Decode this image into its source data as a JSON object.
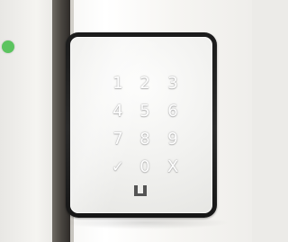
{
  "keypad": {
    "keys": {
      "one": "1",
      "two": "2",
      "three": "3",
      "four": "4",
      "five": "5",
      "six": "6",
      "seven": "7",
      "eight": "8",
      "nine": "9",
      "confirm": "✓",
      "zero": "0",
      "clear": "X"
    },
    "icons": {
      "status": "status-dot-icon",
      "logo": "brand-logo-icon"
    },
    "colors": {
      "status": "#5cc45f",
      "device_frame": "#1b1b1b",
      "key_text": "#ffffff",
      "logo": "#545454"
    }
  }
}
